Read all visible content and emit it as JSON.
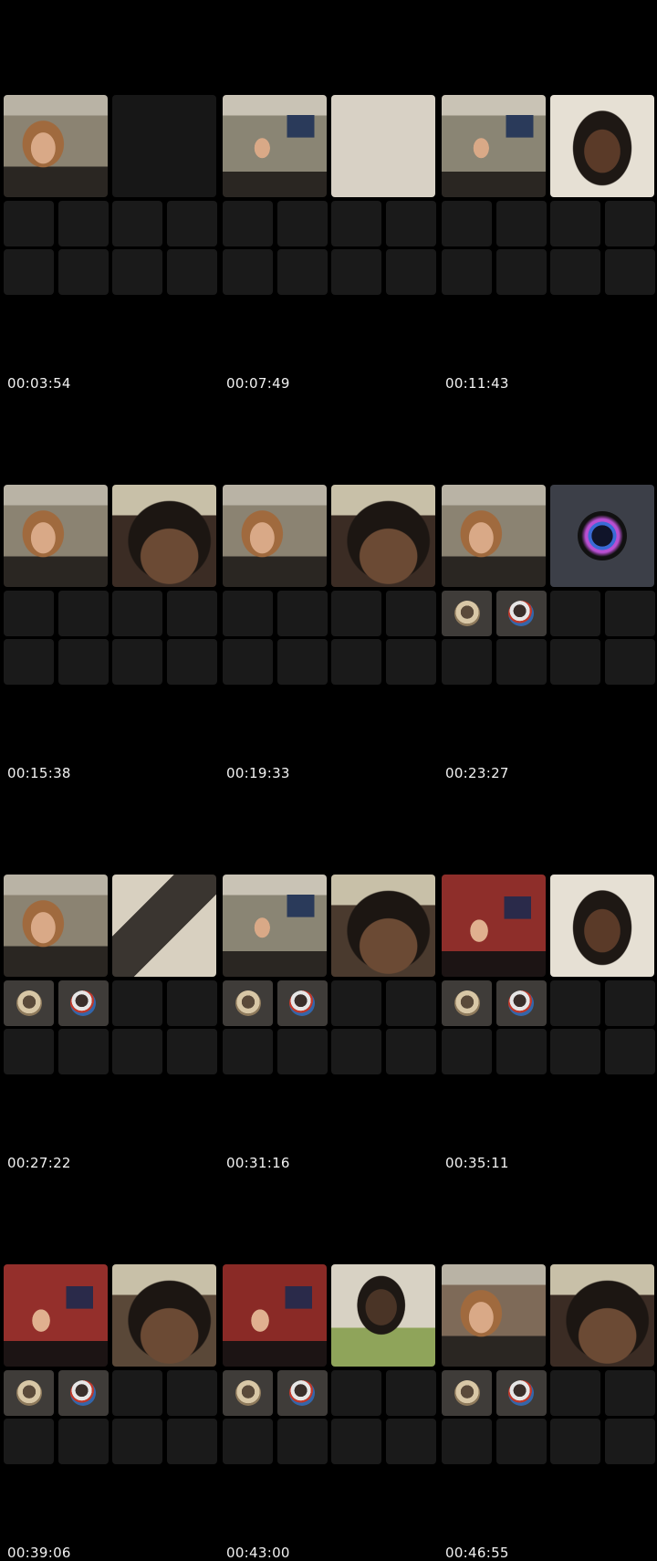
{
  "frames": [
    {
      "timestamp": "00:03:54",
      "tiles": [
        {
          "scene": "girl-room",
          "color": "#8b8372"
        },
        {
          "scene": "empty",
          "color": "#171717"
        }
      ],
      "avatars": false
    },
    {
      "timestamp": "00:07:49",
      "tiles": [
        {
          "scene": "room",
          "color": "#8a8574"
        },
        {
          "scene": "wall",
          "color": "#d4cdc1"
        }
      ],
      "avatars": false
    },
    {
      "timestamp": "00:11:43",
      "tiles": [
        {
          "scene": "room",
          "color": "#8a8574"
        },
        {
          "scene": "man-light",
          "color": "#6e5a4c"
        }
      ],
      "avatars": false
    },
    {
      "timestamp": "00:15:38",
      "tiles": [
        {
          "scene": "girl-room",
          "color": "#8b8372"
        },
        {
          "scene": "man-close",
          "color": "#3b2c24"
        }
      ],
      "avatars": false
    },
    {
      "timestamp": "00:19:33",
      "tiles": [
        {
          "scene": "girl-room",
          "color": "#8b8372"
        },
        {
          "scene": "man-close",
          "color": "#3b2c24"
        }
      ],
      "avatars": false
    },
    {
      "timestamp": "00:23:27",
      "tiles": [
        {
          "scene": "girl-room",
          "color": "#8b8372"
        },
        {
          "scene": "dragon",
          "color": "#3c3f48"
        }
      ],
      "avatars": true
    },
    {
      "timestamp": "00:27:22",
      "tiles": [
        {
          "scene": "girl-room",
          "color": "#8b8372"
        },
        {
          "scene": "poster",
          "color": "#b9b2a4"
        }
      ],
      "avatars": true
    },
    {
      "timestamp": "00:31:16",
      "tiles": [
        {
          "scene": "room",
          "color": "#8a8574"
        },
        {
          "scene": "man-close",
          "color": "#4a3a2e"
        }
      ],
      "avatars": true
    },
    {
      "timestamp": "00:35:11",
      "tiles": [
        {
          "scene": "red-room",
          "color": "#8e2e2a"
        },
        {
          "scene": "man-light",
          "color": "#7a6654"
        }
      ],
      "avatars": true
    },
    {
      "timestamp": "00:39:06",
      "tiles": [
        {
          "scene": "red-room",
          "color": "#942f2b"
        },
        {
          "scene": "man-close",
          "color": "#5a4838"
        }
      ],
      "avatars": true
    },
    {
      "timestamp": "00:43:00",
      "tiles": [
        {
          "scene": "red-room",
          "color": "#8a2a26"
        },
        {
          "scene": "man-green",
          "color": "#7c8a4e"
        }
      ],
      "avatars": true
    },
    {
      "timestamp": "00:46:55",
      "tiles": [
        {
          "scene": "girl-room",
          "color": "#7e6a58"
        },
        {
          "scene": "man-close",
          "color": "#3b2c24"
        }
      ],
      "avatars": true
    }
  ],
  "avatar_icons": [
    "avatar-icon",
    "avatar-icon"
  ],
  "colors": {
    "background": "#000000",
    "tile": "#171717",
    "avatar_tile": "#3f3c39",
    "text": "#f2f2f2"
  }
}
